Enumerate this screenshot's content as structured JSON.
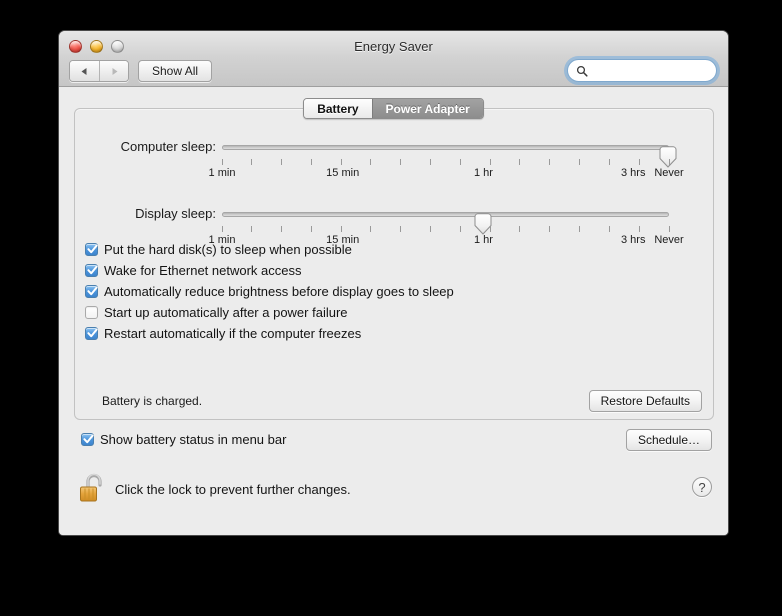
{
  "window": {
    "title": "Energy Saver",
    "traffic_lights": [
      "close-button",
      "minimize-button",
      "zoom-button"
    ],
    "back_label": "◀",
    "forward_label": "▶",
    "show_all_label": "Show All",
    "colors": {
      "close": "#f1544a",
      "minimize": "#f7b62c",
      "zoom": "#d8d8d8",
      "accent_checkbox": "#4b94db",
      "focus_ring": "#6aa8e0",
      "window_bg": "#ececec",
      "lock_body": "#e3a23a"
    }
  },
  "search": {
    "placeholder": "",
    "value": "",
    "icon": "search-icon"
  },
  "tabs": [
    {
      "label": "Battery",
      "selected": true
    },
    {
      "label": "Power Adapter",
      "selected": false
    }
  ],
  "sliders": [
    {
      "label": "Computer sleep:",
      "value_label": "Never",
      "thumb_percent": 100,
      "tick_count": 16,
      "tick_labels": [
        {
          "text": "1 min",
          "percent": 0
        },
        {
          "text": "15 min",
          "percent": 27
        },
        {
          "text": "1 hr",
          "percent": 58.5
        },
        {
          "text": "3 hrs",
          "percent": 92
        },
        {
          "text": "Never",
          "percent": 100
        }
      ]
    },
    {
      "label": "Display sleep:",
      "value_label": "1 hr",
      "thumb_percent": 58.5,
      "tick_count": 16,
      "tick_labels": [
        {
          "text": "1 min",
          "percent": 0
        },
        {
          "text": "15 min",
          "percent": 27
        },
        {
          "text": "1 hr",
          "percent": 58.5
        },
        {
          "text": "3 hrs",
          "percent": 92
        },
        {
          "text": "Never",
          "percent": 100
        }
      ]
    }
  ],
  "checkboxes": [
    {
      "label": "Put the hard disk(s) to sleep when possible",
      "checked": true
    },
    {
      "label": "Wake for Ethernet network access",
      "checked": true
    },
    {
      "label": "Automatically reduce brightness before display goes to sleep",
      "checked": true
    },
    {
      "label": "Start up automatically after a power failure",
      "checked": false
    },
    {
      "label": "Restart automatically if the computer freezes",
      "checked": true
    }
  ],
  "status_text": "Battery is charged.",
  "restore_defaults_label": "Restore Defaults",
  "menu_bar_option": {
    "label": "Show battery status in menu bar",
    "checked": true
  },
  "schedule_label": "Schedule…",
  "lock": {
    "icon": "unlocked-padlock-icon",
    "text": "Click the lock to prevent further changes."
  },
  "help_label": "?"
}
